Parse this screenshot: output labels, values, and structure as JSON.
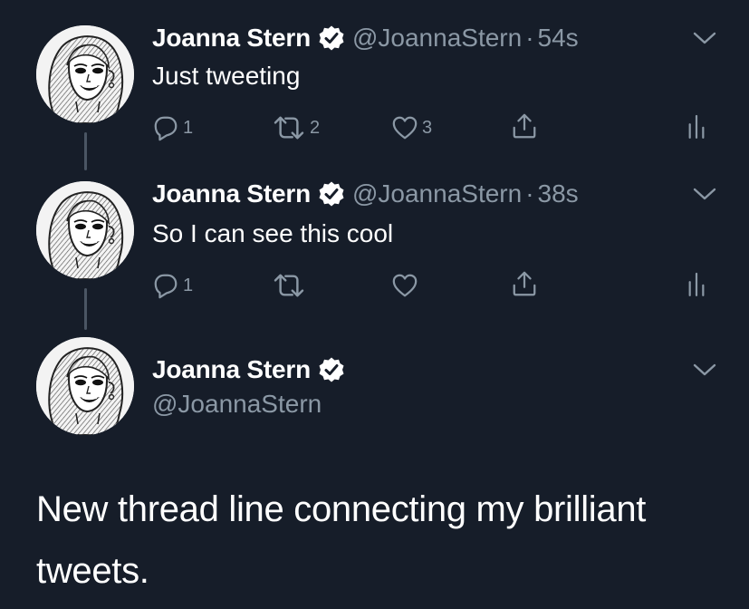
{
  "colors": {
    "background": "#161d29",
    "text_primary": "#ffffff",
    "text_secondary": "#8b98a5",
    "thread_line": "#4a5563"
  },
  "tweets": [
    {
      "name": "Joanna Stern",
      "handle": "@JoannaStern",
      "separator": "·",
      "time": "54s",
      "text": "Just tweeting",
      "reply_count": "1",
      "retweet_count": "2",
      "like_count": "3"
    },
    {
      "name": "Joanna Stern",
      "handle": "@JoannaStern",
      "separator": "·",
      "time": "38s",
      "text": "So I can see this cool",
      "reply_count": "1",
      "retweet_count": "",
      "like_count": ""
    }
  ],
  "main_tweet": {
    "name": "Joanna Stern",
    "handle": "@JoannaStern",
    "text": "New thread line connecting my brilliant tweets."
  },
  "icons": {
    "reply": "reply-icon",
    "retweet": "retweet-icon",
    "like": "heart-icon",
    "share": "share-icon",
    "analytics": "analytics-icon",
    "verified": "verified-badge-icon",
    "more": "chevron-down-icon"
  }
}
